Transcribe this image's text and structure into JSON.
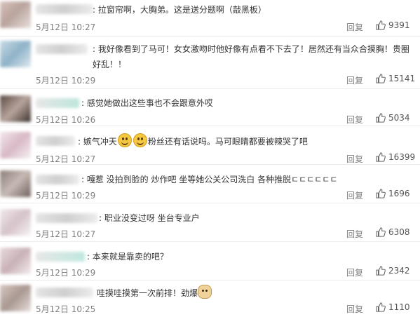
{
  "comments": [
    {
      "text": "拉窗帘啊，大胸弟。这是送分题啊（敲黑板）",
      "date": "5月12日",
      "time": "10:27",
      "reply": "回复",
      "likes": "9391"
    },
    {
      "text": "我好像看到了马可！女女激吻时他好像有点看不下去了！居然还有当众合摸胸！贵圈好乱！！",
      "date": "5月12日",
      "time": "10:29",
      "reply": "回复",
      "likes": "15141"
    },
    {
      "text": "感觉她做出这些事也不会跟意外哎",
      "date": "5月12日",
      "time": "10:26",
      "reply": "回复",
      "likes": "5034"
    },
    {
      "text_a": "嫉气冲天",
      "text_b": "粉丝还有话说吗。马可眼睛都要被辣哭了吧",
      "date": "5月12日",
      "time": "10:27",
      "reply": "回复",
      "likes": "16399"
    },
    {
      "text": "嘎惹 没拍到脸的 炒作吧 坐等她公关公司洗白 各种推脱ㄷㄷㄷㄷㄷㄷ",
      "date": "5月12日",
      "time": "10:29",
      "reply": "回复",
      "likes": "1696"
    },
    {
      "text": "职业没变过呀 坐台专业户",
      "date": "5月12日",
      "time": "10:27",
      "reply": "回复",
      "likes": "6308"
    },
    {
      "text": "本来就是靠卖的吧？",
      "date": "5月12日",
      "time": "10:29",
      "reply": "回复",
      "likes": "2342"
    },
    {
      "text": "哇摸哇摸第一次前排！劲爆",
      "date": "5月12日",
      "time": "10:25",
      "reply": "回复",
      "likes": "1110"
    }
  ]
}
